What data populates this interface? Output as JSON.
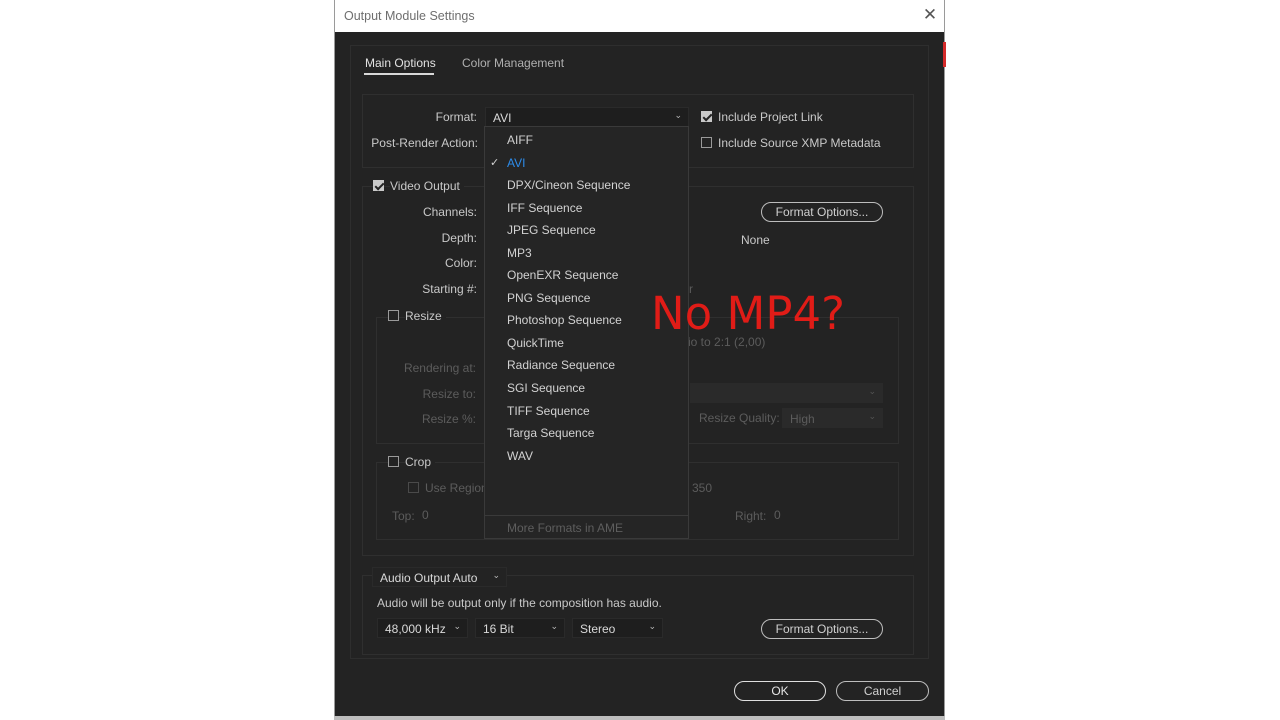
{
  "window": {
    "title": "Output Module Settings"
  },
  "tabs": [
    {
      "label": "Main Options",
      "active": true
    },
    {
      "label": "Color Management",
      "active": false
    }
  ],
  "main": {
    "format_label": "Format:",
    "format_value": "AVI",
    "post_render_label": "Post-Render Action:",
    "include_project_link": {
      "label": "Include Project Link",
      "checked": true
    },
    "include_xmp": {
      "label": "Include Source XMP Metadata",
      "checked": false
    }
  },
  "video": {
    "label": "Video Output",
    "checked": true,
    "channels_label": "Channels:",
    "depth_label": "Depth:",
    "color_label": "Color:",
    "starting_label": "Starting #:",
    "format_options_label": "Format Options...",
    "codec_value": "None",
    "hidden_fragment": "r"
  },
  "resize": {
    "label": "Resize",
    "rendering_at_label": "Rendering at:",
    "resize_to_label": "Resize to:",
    "resize_pct_label": "Resize %:",
    "ratio_text": "atio to 2:1 (2,00)",
    "quality_label": "Resize Quality:",
    "quality_value": "High"
  },
  "crop": {
    "label": "Crop",
    "use_region_label": "Use Region",
    "region_value": "350",
    "top_label": "Top:",
    "top_value": "0",
    "right_label": "Right:",
    "right_value": "0"
  },
  "format_dropdown": {
    "items": [
      "AIFF",
      "AVI",
      "DPX/Cineon Sequence",
      "IFF Sequence",
      "JPEG Sequence",
      "MP3",
      "OpenEXR Sequence",
      "PNG Sequence",
      "Photoshop Sequence",
      "QuickTime",
      "Radiance Sequence",
      "SGI Sequence",
      "TIFF Sequence",
      "Targa Sequence",
      "WAV"
    ],
    "selected_index": 1,
    "more_formats": "More Formats in AME"
  },
  "audio": {
    "output_label": "Audio Output Auto",
    "note": "Audio will be output only if the composition has audio.",
    "sample_rate": "48,000 kHz",
    "bit_depth": "16 Bit",
    "channels": "Stereo",
    "format_options_label": "Format Options..."
  },
  "buttons": {
    "ok": "OK",
    "cancel": "Cancel"
  },
  "annotation": {
    "text": "No MP4?",
    "color": "#e01c17"
  },
  "icons": {
    "close": "close-icon",
    "check": "checkmark-icon",
    "chevron": "chevron-down-icon"
  }
}
